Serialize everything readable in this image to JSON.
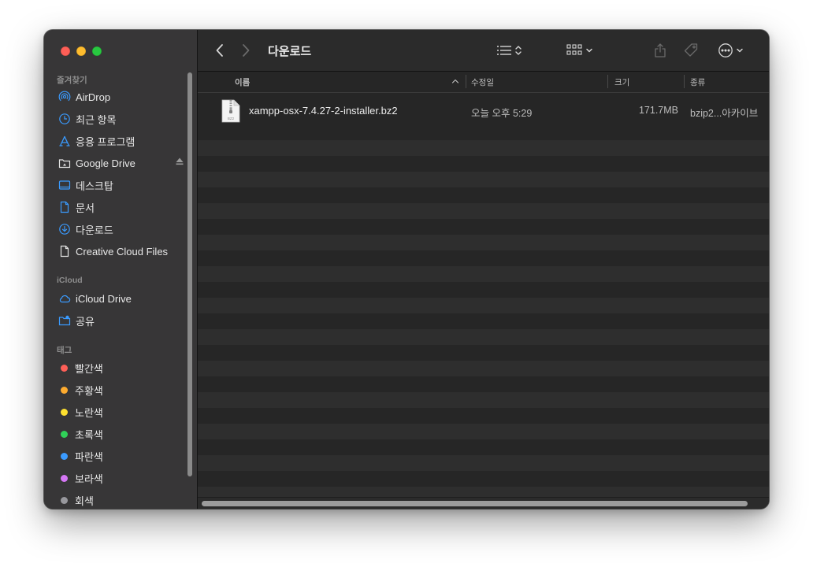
{
  "window": {
    "title": "다운로드"
  },
  "sidebar": {
    "favorites_title": "즐겨찾기",
    "favorites": [
      {
        "label": "AirDrop",
        "icon": "airdrop-icon"
      },
      {
        "label": "최근 항목",
        "icon": "clock-icon"
      },
      {
        "label": "응용 프로그램",
        "icon": "applications-icon"
      },
      {
        "label": "Google Drive",
        "icon": "drive-folder-icon"
      },
      {
        "label": "데스크탑",
        "icon": "desktop-icon"
      },
      {
        "label": "문서",
        "icon": "document-icon"
      },
      {
        "label": "다운로드",
        "icon": "download-icon"
      },
      {
        "label": "Creative Cloud Files",
        "icon": "file-icon"
      }
    ],
    "icloud_title": "iCloud",
    "icloud": [
      {
        "label": "iCloud Drive",
        "icon": "cloud-icon"
      },
      {
        "label": "공유",
        "icon": "shared-folder-icon"
      }
    ],
    "tags_title": "태그",
    "tags": [
      {
        "label": "빨간색",
        "color": "#fe5f57"
      },
      {
        "label": "주황색",
        "color": "#fdab2f"
      },
      {
        "label": "노란색",
        "color": "#fde02f"
      },
      {
        "label": "초록색",
        "color": "#30d158"
      },
      {
        "label": "파란색",
        "color": "#3a9bff"
      },
      {
        "label": "보라색",
        "color": "#d577f5"
      },
      {
        "label": "회색",
        "color": "#98989d"
      }
    ]
  },
  "columns": {
    "name": "이름",
    "date": "수정일",
    "size": "크기",
    "kind": "종류"
  },
  "files": [
    {
      "name": "xampp-osx-7.4.27-2-installer.bz2",
      "date": "오늘 오후 5:29",
      "size": "171.7MB",
      "kind": "bzip2...아카이브",
      "icon": "bz2-file-icon"
    }
  ],
  "colors": {
    "accent": "#3a9bff",
    "sidebar_bg": "#373637",
    "content_bg": "#262626"
  }
}
